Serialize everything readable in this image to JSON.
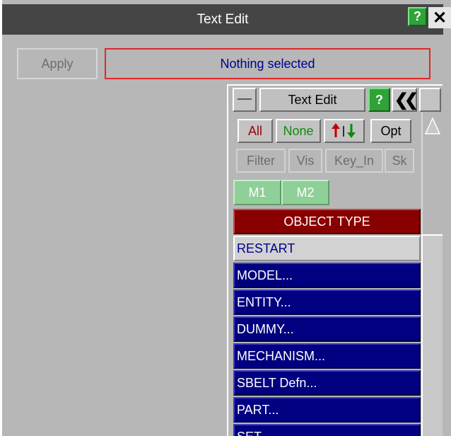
{
  "window": {
    "title": "Text Edit",
    "help_label": "?",
    "close_label": "✕"
  },
  "main": {
    "apply_label": "Apply",
    "selection_status": "Nothing selected"
  },
  "panel": {
    "title": "Text Edit",
    "help_label": "?",
    "collapse_label": "❮❮",
    "row1": {
      "all": "All",
      "none": "None",
      "opt": "Opt"
    },
    "row2": {
      "filter": "Filter",
      "vis": "Vis",
      "key_in": "Key_In",
      "sk": "Sk"
    },
    "modes": [
      "M1",
      "M2"
    ],
    "list_header": "OBJECT TYPE",
    "items": [
      "RESTART",
      "MODEL...",
      "ENTITY...",
      "DUMMY...",
      "MECHANISM...",
      "SBELT Defn...",
      "PART...",
      "SET..."
    ]
  },
  "colors": {
    "accent_green": "#2fa336",
    "header_red": "#880000",
    "list_blue": "#000080",
    "selection_border": "#e32626"
  }
}
